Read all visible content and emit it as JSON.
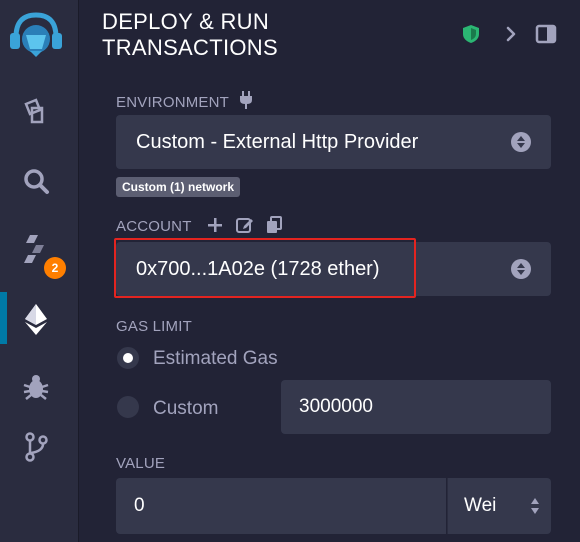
{
  "header": {
    "title_line1": "DEPLOY & RUN",
    "title_line2": "TRANSACTIONS"
  },
  "sidebar": {
    "items": [
      {
        "icon": "remix-logo-icon"
      },
      {
        "icon": "file-explorer-icon"
      },
      {
        "icon": "search-icon"
      },
      {
        "icon": "solidity-compiler-icon",
        "badge": "2"
      },
      {
        "icon": "deploy-run-icon",
        "active": true
      },
      {
        "icon": "debugger-icon"
      },
      {
        "icon": "git-icon"
      }
    ]
  },
  "environment": {
    "label": "ENVIRONMENT",
    "value": "Custom - External Http Provider",
    "network_badge": "Custom (1) network"
  },
  "account": {
    "label": "ACCOUNT",
    "value": "0x700...1A02e (1728 ether)"
  },
  "gas_limit": {
    "label": "GAS LIMIT",
    "estimated_label": "Estimated Gas",
    "custom_label": "Custom",
    "custom_value": "3000000",
    "selected": "estimated"
  },
  "value": {
    "label": "VALUE",
    "amount": "0",
    "unit": "Wei"
  },
  "colors": {
    "accent": "#007aa6",
    "highlight": "#e32420",
    "badge": "#ff7f00",
    "shield": "#2bb673"
  }
}
